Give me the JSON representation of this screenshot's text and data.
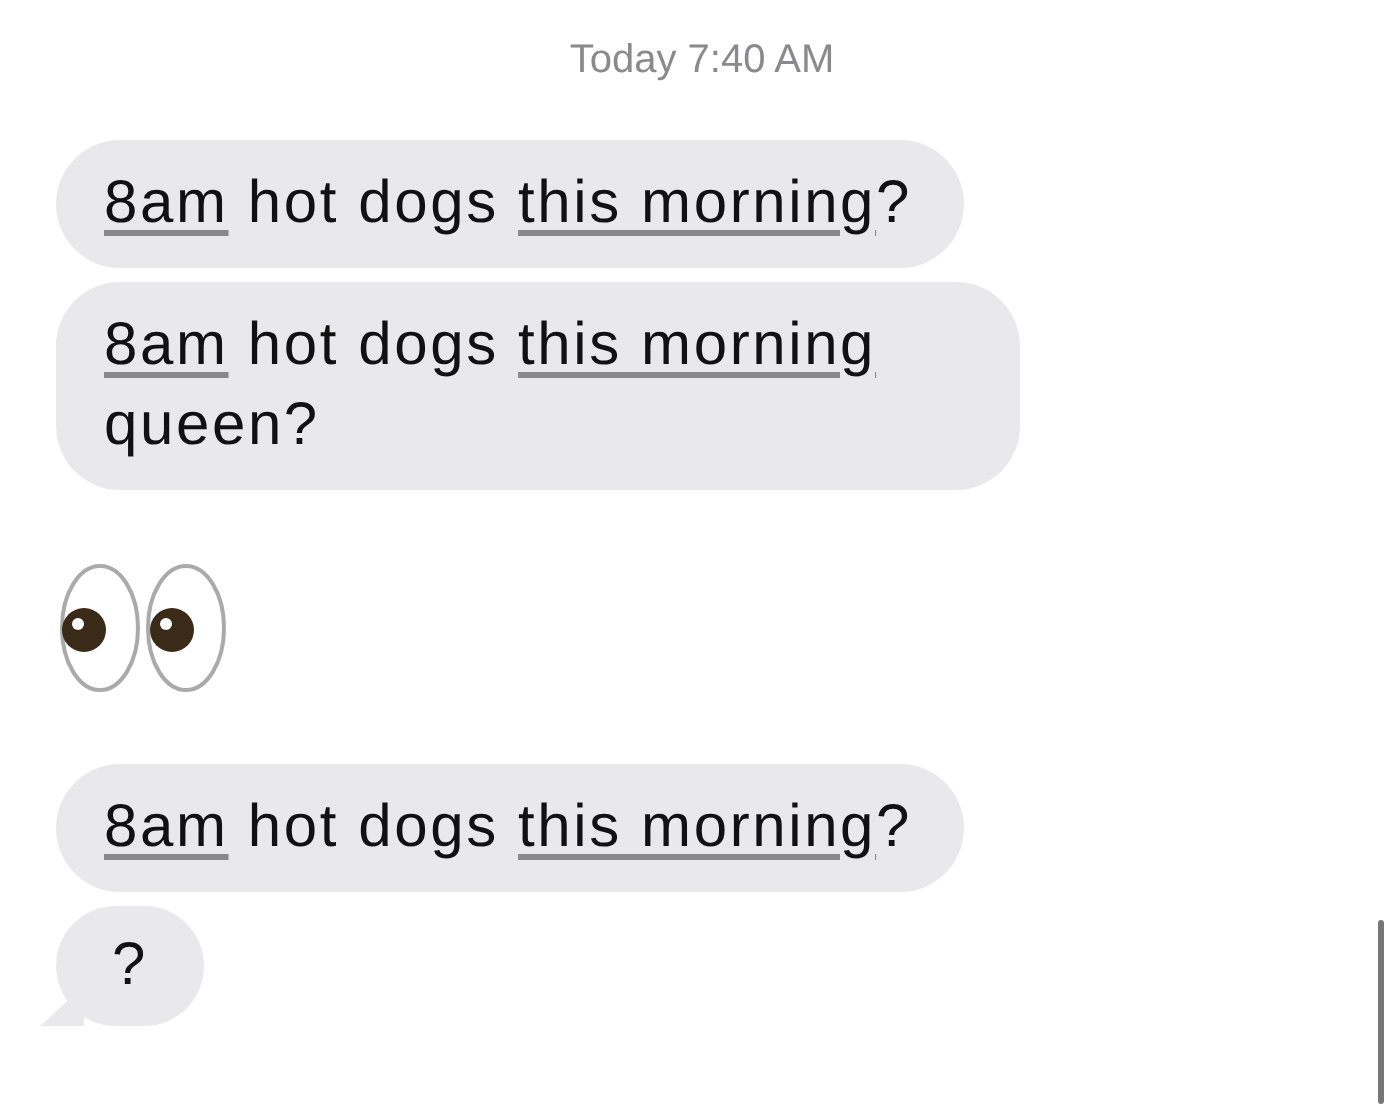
{
  "timestamp": "Today 7:40 AM",
  "messages": [
    {
      "kind": "text",
      "tail": false,
      "parts": [
        {
          "text": "8am",
          "link": true
        },
        {
          "text": " hot dogs ",
          "link": false
        },
        {
          "text": "this morning",
          "link": true
        },
        {
          "text": "?",
          "link": false
        }
      ]
    },
    {
      "kind": "text",
      "tail": false,
      "parts": [
        {
          "text": "8am",
          "link": true
        },
        {
          "text": " hot dogs ",
          "link": false
        },
        {
          "text": "this morning",
          "link": true
        },
        {
          "text": " queen?",
          "link": false
        }
      ]
    },
    {
      "kind": "emoji"
    },
    {
      "kind": "text",
      "tail": false,
      "parts": [
        {
          "text": "8am",
          "link": true
        },
        {
          "text": " hot dogs ",
          "link": false
        },
        {
          "text": "this morning",
          "link": true
        },
        {
          "text": "?",
          "link": false
        }
      ]
    },
    {
      "kind": "text",
      "tail": true,
      "parts": [
        {
          "text": "?",
          "link": false
        }
      ]
    }
  ]
}
